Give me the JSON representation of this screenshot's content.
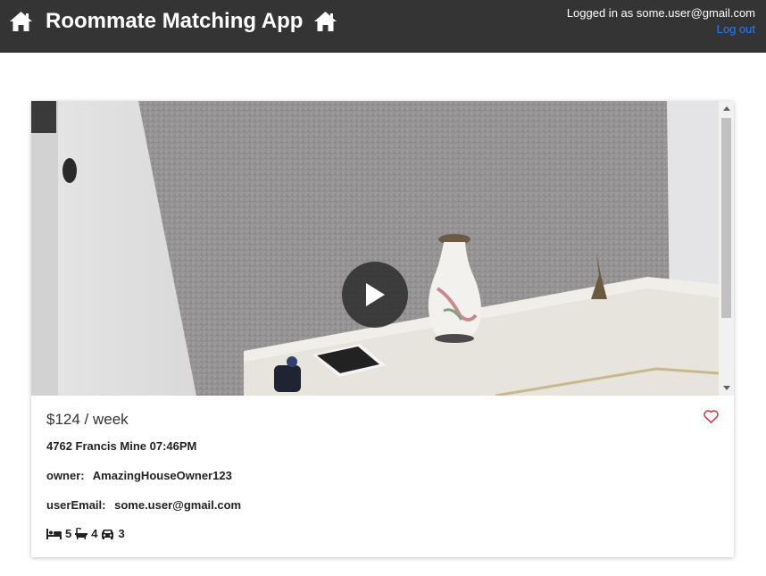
{
  "header": {
    "title": "Roommate Matching App",
    "logged_in_text": "Logged in as some.user@gmail.com",
    "logout_label": "Log out",
    "brand_color": "#343434",
    "link_color": "#2f7bf5"
  },
  "listing": {
    "price": "$124 / week",
    "address_time": "4762 Francis Mine 07:46PM",
    "owner_label": "owner:",
    "owner_value": "AmazingHouseOwner123",
    "email_label": "userEmail:",
    "email_value": "some.user@gmail.com",
    "amenities": [
      {
        "icon": "bed-icon",
        "count": "5"
      },
      {
        "icon": "bath-icon",
        "count": "4"
      },
      {
        "icon": "car-icon",
        "count": "3"
      }
    ],
    "favorite_color": "#dc3545"
  }
}
